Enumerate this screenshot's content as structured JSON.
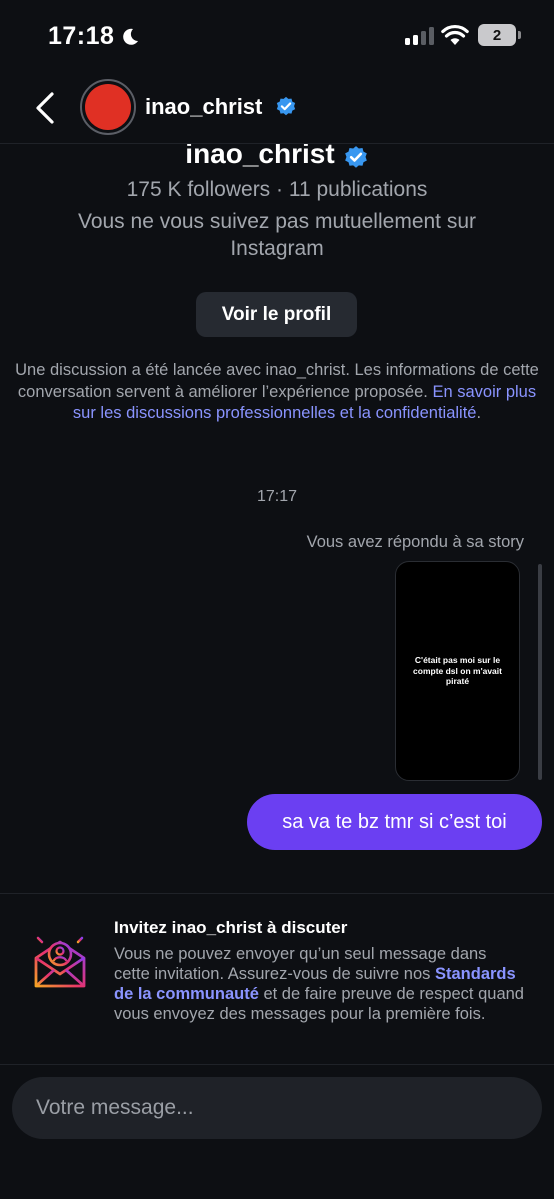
{
  "status_bar": {
    "time": "17:18",
    "battery": "2"
  },
  "header": {
    "username": "inao_christ"
  },
  "profile": {
    "name": "inao_christ",
    "stats": "175 K followers · 11 publications",
    "relation_line1": "Vous ne vous suivez pas mutuellement sur",
    "relation_line2": "Instagram",
    "view_profile_label": "Voir le profil"
  },
  "notice": {
    "text": "Une discussion a été lancée avec inao_christ. Les informations de cette conversation servent à améliorer l’expérience proposée. ",
    "link": "En savoir plus sur les discussions professionnelles et la confidentialité",
    "end": "."
  },
  "conversation": {
    "timestamp": "17:17",
    "story_reply_label": "Vous avez répondu à sa story",
    "story_text": "C'était pas moi sur le compte dsl on m'avait piraté",
    "message": "sa va te bz tmr si c’est toi"
  },
  "invite": {
    "title": "Invitez inao_christ à discuter",
    "text_before": "Vous ne pouvez envoyer qu’un seul message dans cette invitation. Assurez-vous de suivre nos ",
    "link": "Standards de la communauté",
    "text_after": " et de faire preuve de respect quand vous envoyez des messages pour la première fois."
  },
  "composer": {
    "placeholder": "Votre message..."
  },
  "colors": {
    "bubble": "#6b3ff2",
    "link": "#8a94ff",
    "verified": "#3897f0",
    "avatar": "#e03024"
  },
  "icons": [
    "moon-icon",
    "signal-icon",
    "wifi-icon",
    "battery-icon",
    "back-icon",
    "verified-icon",
    "invite-envelope-icon"
  ]
}
